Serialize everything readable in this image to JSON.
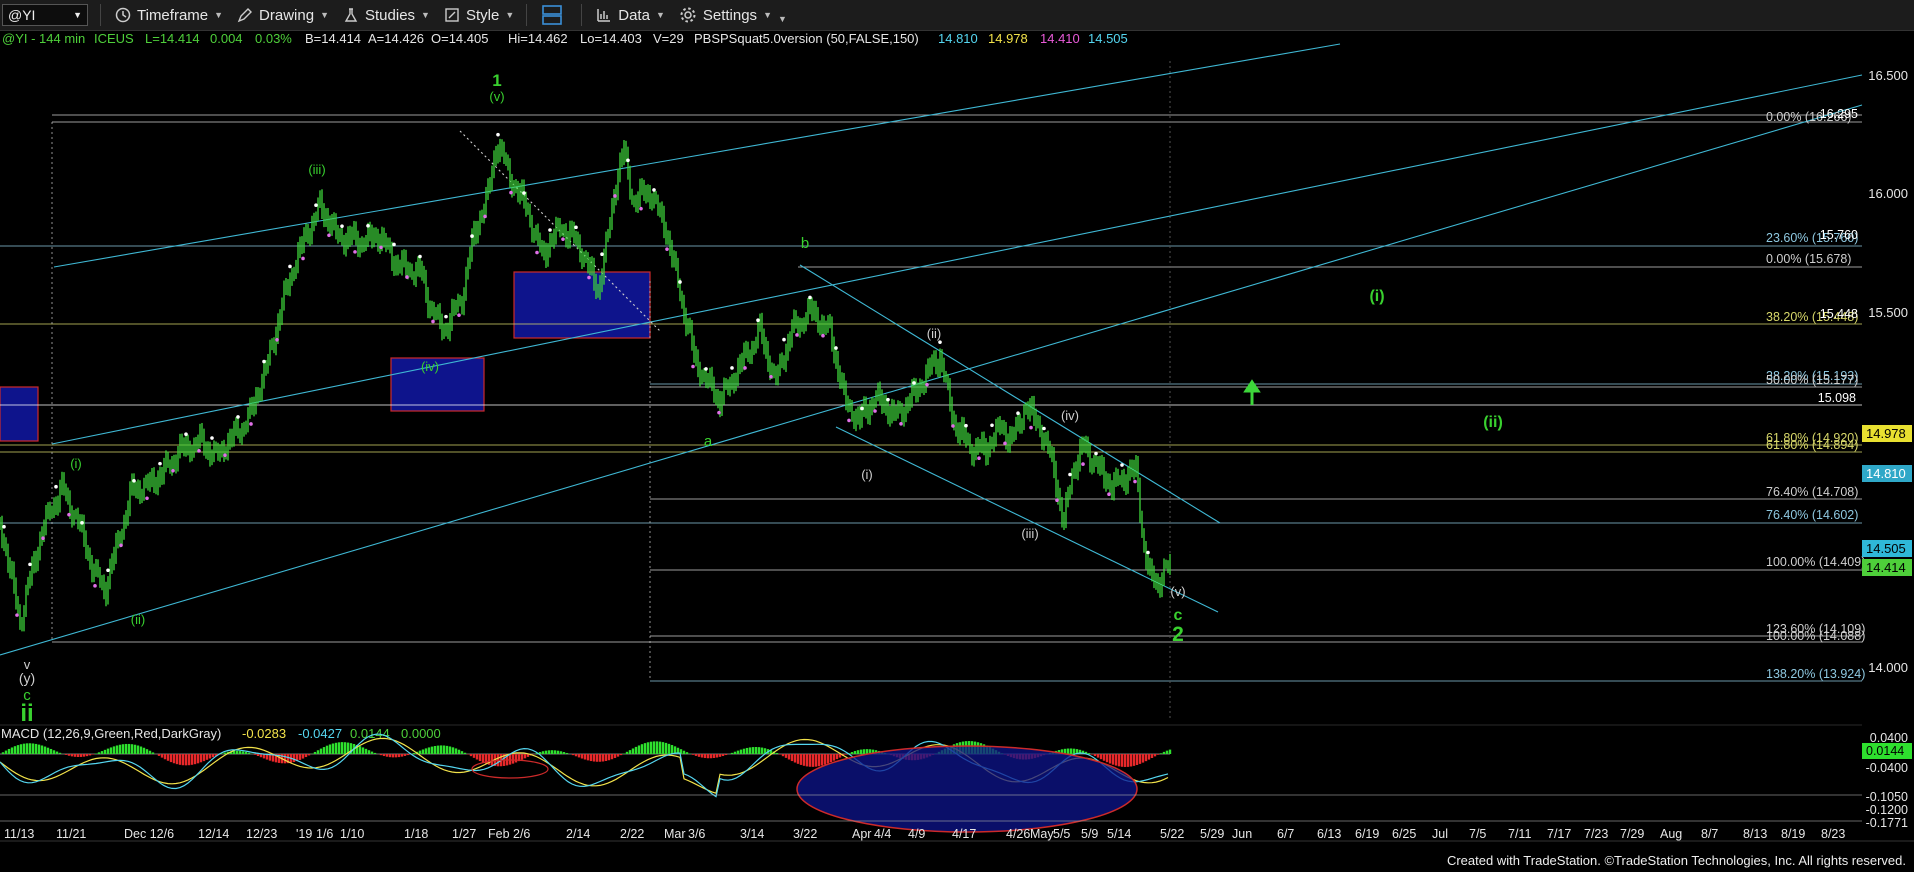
{
  "toolbar": {
    "symbol": "@YI",
    "timeframe": "Timeframe",
    "drawing": "Drawing",
    "studies": "Studies",
    "style": "Style",
    "data": "Data",
    "settings": "Settings"
  },
  "info_bar": {
    "symbol_interval": "@YI - 144 min",
    "exchange": "ICEUS",
    "last": "L=14.414",
    "change": "0.004",
    "change_pct": "0.03%",
    "bid": "B=14.414",
    "ask": "A=14.426",
    "open": "O=14.405",
    "high": "Hi=14.462",
    "low": "Lo=14.403",
    "volume": "V=29",
    "study_name": "PBSPSquat5.0version (50,FALSE,150)",
    "study_values": [
      {
        "text": "14.810",
        "color": "#55d6f0"
      },
      {
        "text": "14.978",
        "color": "#f2e24a"
      },
      {
        "text": "14.410",
        "color": "#e85ad8"
      },
      {
        "text": "14.505",
        "color": "#55d6f0"
      }
    ]
  },
  "price_axis": {
    "labels": [
      "16.500",
      "16.000",
      "15.500",
      "14.000"
    ],
    "tags": [
      {
        "text": "14.978",
        "color": "#e8e030",
        "textcolor": "#000"
      },
      {
        "text": "14.810",
        "color": "#2fa8c8",
        "textcolor": "#fff"
      },
      {
        "text": "14.505",
        "color": "#2fb8d8",
        "textcolor": "#000"
      },
      {
        "text": "14.414",
        "color": "#4ecf3a",
        "textcolor": "#000"
      }
    ]
  },
  "fib_levels": [
    {
      "label": "0.00% (16.266)",
      "extra": "16.295",
      "color": "#cfcfcf"
    },
    {
      "label": "23.60% (15.760)",
      "extra": "15.760",
      "color": "#8ec8e0"
    },
    {
      "label": "0.00% (15.678)",
      "extra": "",
      "color": "#cfcfcf"
    },
    {
      "label": "38.20% (15.448)",
      "extra": "15.448",
      "color": "#d8d86a"
    },
    {
      "label": "38.20% (15.193)",
      "extra": "",
      "color": "#8ec8e0"
    },
    {
      "label": "50.00% (15.177)",
      "extra": "",
      "color": "#cfcfcf"
    },
    {
      "label": "15.098",
      "extra": "",
      "color": "#ffffff"
    },
    {
      "label": "61.80% (14.920)",
      "extra": "",
      "color": "#d8d86a"
    },
    {
      "label": "61.80% (14.894)",
      "extra": "",
      "color": "#d8d86a"
    },
    {
      "label": "76.40% (14.708)",
      "extra": "",
      "color": "#cfcfcf"
    },
    {
      "label": "76.40% (14.602)",
      "extra": "",
      "color": "#8ec8e0"
    },
    {
      "label": "100.00% (14.409)",
      "extra": "",
      "color": "#cfcfcf"
    },
    {
      "label": "123.60% (14.109)",
      "extra": "",
      "color": "#cfcfcf"
    },
    {
      "label": "100.00% (14.088)",
      "extra": "",
      "color": "#cfcfcf"
    },
    {
      "label": "138.20% (13.924)",
      "extra": "",
      "color": "#8ec8e0"
    }
  ],
  "wave_labels": [
    {
      "text": "1",
      "color": "#39d12f"
    },
    {
      "text": "(v)",
      "color": "#39d12f"
    },
    {
      "text": "(iii)",
      "color": "#39d12f"
    },
    {
      "text": "(iv)",
      "color": "#39d12f"
    },
    {
      "text": "(i)",
      "color": "#39d12f"
    },
    {
      "text": "(ii)",
      "color": "#39d12f"
    },
    {
      "text": "b",
      "color": "#39d12f"
    },
    {
      "text": "a",
      "color": "#39d12f"
    },
    {
      "text": "(ii)",
      "color": "#cfcfcf"
    },
    {
      "text": "(i)",
      "color": "#cfcfcf"
    },
    {
      "text": "(iv)",
      "color": "#cfcfcf"
    },
    {
      "text": "(iii)",
      "color": "#cfcfcf"
    },
    {
      "text": "(v)",
      "color": "#cfcfcf"
    },
    {
      "text": "c",
      "color": "#39d12f"
    },
    {
      "text": "2",
      "color": "#39d12f"
    },
    {
      "text": "(i)",
      "color": "#39d12f"
    },
    {
      "text": "(ii)",
      "color": "#39d12f"
    },
    {
      "text": "v",
      "color": "#cfcfcf"
    },
    {
      "text": "(y)",
      "color": "#cfcfcf"
    },
    {
      "text": "c",
      "color": "#39d12f"
    },
    {
      "text": "ii",
      "color": "#39d12f"
    }
  ],
  "macd": {
    "title": "MACD (12,26,9,Green,Red,DarkGray)",
    "values": [
      {
        "text": "-0.0283",
        "color": "#f2e24a"
      },
      {
        "text": "-0.0427",
        "color": "#55d6f0"
      },
      {
        "text": "0.0144",
        "color": "#4ecf3a"
      },
      {
        "text": "0.0000",
        "color": "#4ecf3a"
      }
    ],
    "axis_labels": [
      "0.0400",
      "-0.0400",
      "-0.1050",
      "-0.1200",
      "-0.1771"
    ],
    "tag": "0.0144"
  },
  "time_axis": [
    "11/13",
    "11/21",
    "Dec 12/6",
    "12/14",
    "12/23",
    "'19",
    "1/6",
    "1/10",
    "1/18",
    "1/27",
    "Feb 2/6",
    "2/14",
    "2/22",
    "Mar",
    "3/6",
    "3/14",
    "3/22",
    "Apr",
    "4/4",
    "4/9",
    "4/17",
    "4/26",
    "May",
    "5/5",
    "5/9",
    "5/14",
    "5/22",
    "5/29",
    "Jun",
    "6/7",
    "6/13",
    "6/19",
    "6/25",
    "Jul",
    "7/5",
    "7/11",
    "7/17",
    "7/23",
    "7/29",
    "Aug",
    "8/7",
    "8/13",
    "8/19",
    "8/23"
  ],
  "footer": "Created with TradeStation. ©TradeStation Technologies, Inc. All rights reserved."
}
